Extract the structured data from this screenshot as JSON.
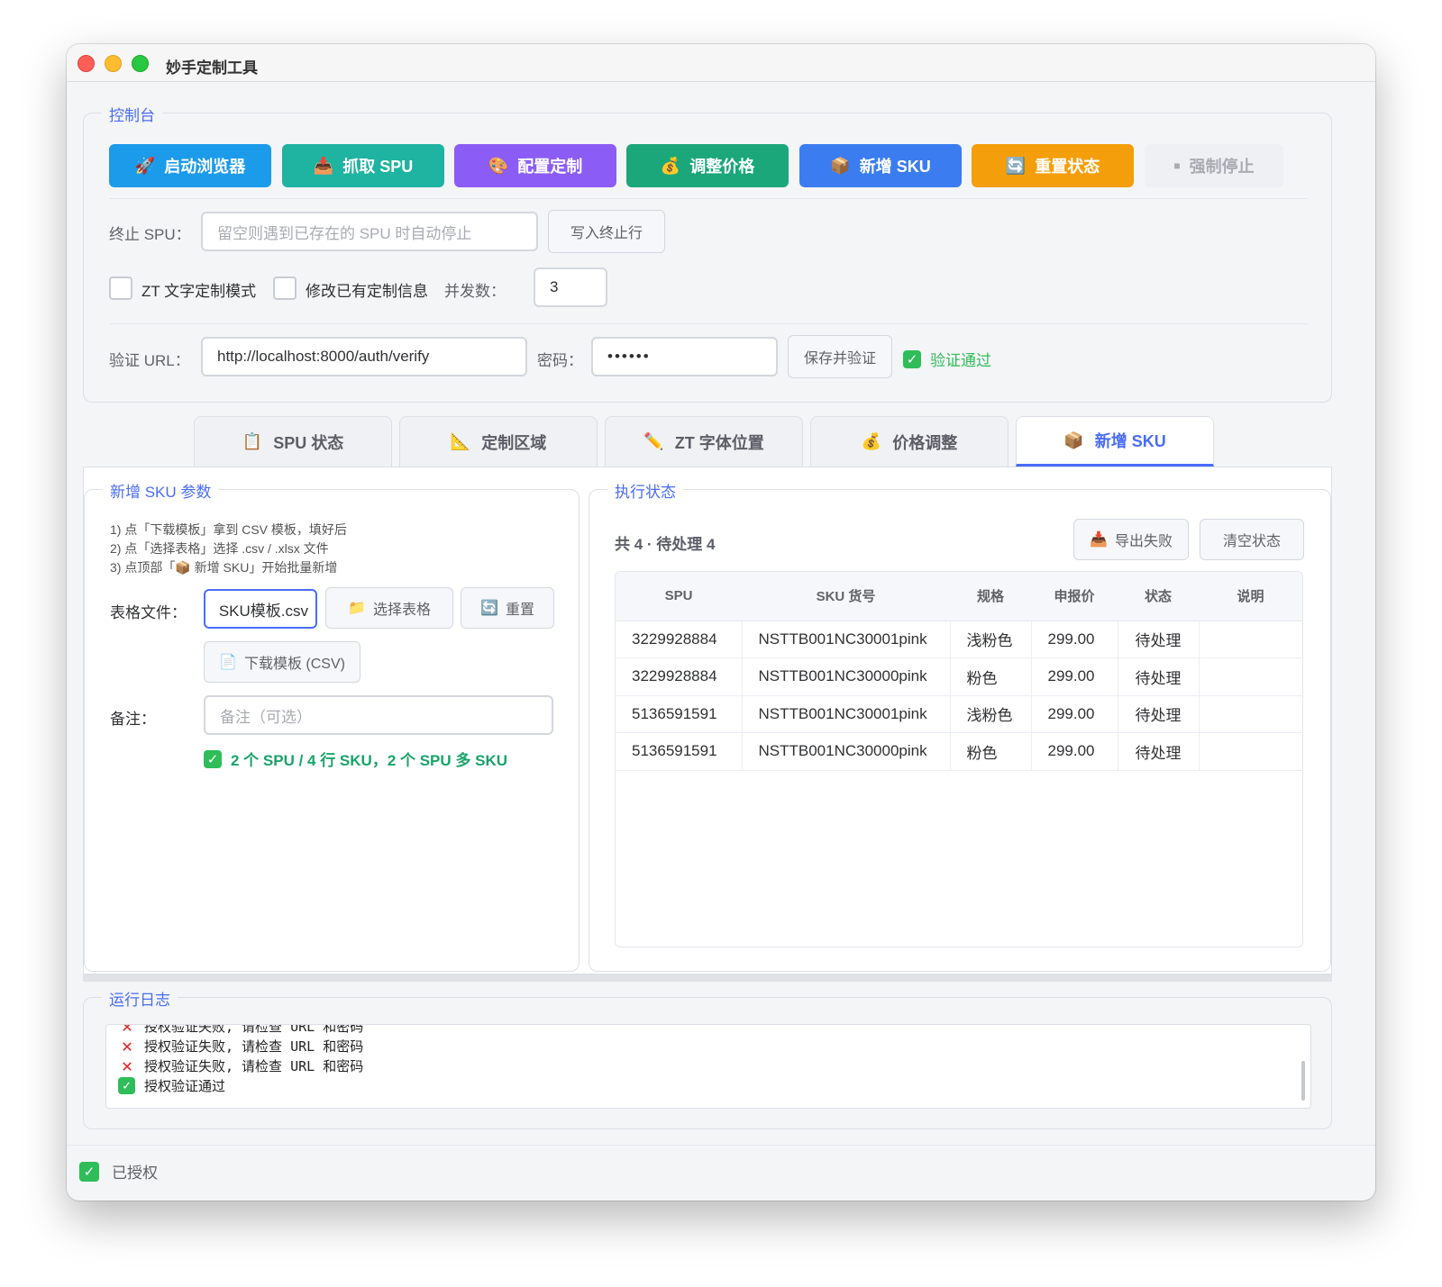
{
  "window": {
    "title": "妙手定制工具"
  },
  "console": {
    "title": "控制台",
    "buttons": [
      {
        "label": "启动浏览器",
        "icon": "🚀",
        "color": "#1c9bea"
      },
      {
        "label": "抓取 SPU",
        "icon": "📥",
        "color": "#1fb3a1"
      },
      {
        "label": "配置定制",
        "icon": "🎨",
        "color": "#8b5cf6"
      },
      {
        "label": "调整价格",
        "icon": "💰",
        "color": "#1ba77a"
      },
      {
        "label": "新增 SKU",
        "icon": "📦",
        "color": "#3b7cf0"
      },
      {
        "label": "重置状态",
        "icon": "🔄",
        "color": "#f59e0b"
      },
      {
        "label": "强制停止",
        "icon": "■",
        "color": "#eef0f3"
      }
    ],
    "stop_spu": {
      "label": "终止 SPU：",
      "placeholder": "留空则遇到已存在的 SPU 时自动停止",
      "button": "写入终止行"
    },
    "zt_mode_label": "ZT 文字定制模式",
    "modify_label": "修改已有定制信息",
    "concurrency_label": "并发数：",
    "concurrency_value": "3",
    "verify_url_label": "验证 URL：",
    "verify_url_value": "http://localhost:8000/auth/verify",
    "password_label": "密码：",
    "password_value": "••••••",
    "save_verify_button": "保存并验证",
    "verify_status": "验证通过"
  },
  "tabs": [
    {
      "label": "SPU 状态",
      "icon": "📋"
    },
    {
      "label": "定制区域",
      "icon": "📐"
    },
    {
      "label": "ZT 字体位置",
      "icon": "✏️"
    },
    {
      "label": "价格调整",
      "icon": "💰"
    },
    {
      "label": "新增 SKU",
      "icon": "📦",
      "active": true
    }
  ],
  "sku_params": {
    "title": "新增 SKU 参数",
    "instructions": [
      "1) 点「下载模板」拿到 CSV 模板，填好后",
      "2) 点「选择表格」选择 .csv / .xlsx 文件",
      "3) 点顶部「📦 新增 SKU」开始批量新增"
    ],
    "file_label": "表格文件：",
    "file_value": "SKU模板.csv",
    "choose_button": "选择表格",
    "reset_button": "重置",
    "download_button": "下载模板 (CSV)",
    "note_label": "备注：",
    "note_placeholder": "备注（可选）",
    "summary": "2 个 SPU / 4 行 SKU，2 个 SPU 多 SKU"
  },
  "exec_status": {
    "title": "执行状态",
    "summary": "共 4 · 待处理 4",
    "export_button": "导出失败",
    "clear_button": "清空状态",
    "columns": [
      "SPU",
      "SKU 货号",
      "规格",
      "申报价",
      "状态",
      "说明"
    ],
    "rows": [
      [
        "3229928884",
        "NSTTB001NC30001pink",
        "浅粉色",
        "299.00",
        "待处理",
        ""
      ],
      [
        "3229928884",
        "NSTTB001NC30000pink",
        "粉色",
        "299.00",
        "待处理",
        ""
      ],
      [
        "5136591591",
        "NSTTB001NC30001pink",
        "浅粉色",
        "299.00",
        "待处理",
        ""
      ],
      [
        "5136591591",
        "NSTTB001NC30000pink",
        "粉色",
        "299.00",
        "待处理",
        ""
      ]
    ]
  },
  "log": {
    "title": "运行日志",
    "lines": [
      {
        "status": "error",
        "text": "授权验证失败, 请检查 URL 和密码"
      },
      {
        "status": "error",
        "text": "授权验证失败, 请检查 URL 和密码"
      },
      {
        "status": "error",
        "text": "授权验证失败, 请检查 URL 和密码"
      },
      {
        "status": "ok",
        "text": "授权验证通过"
      }
    ]
  },
  "statusbar": {
    "text": "已授权"
  }
}
